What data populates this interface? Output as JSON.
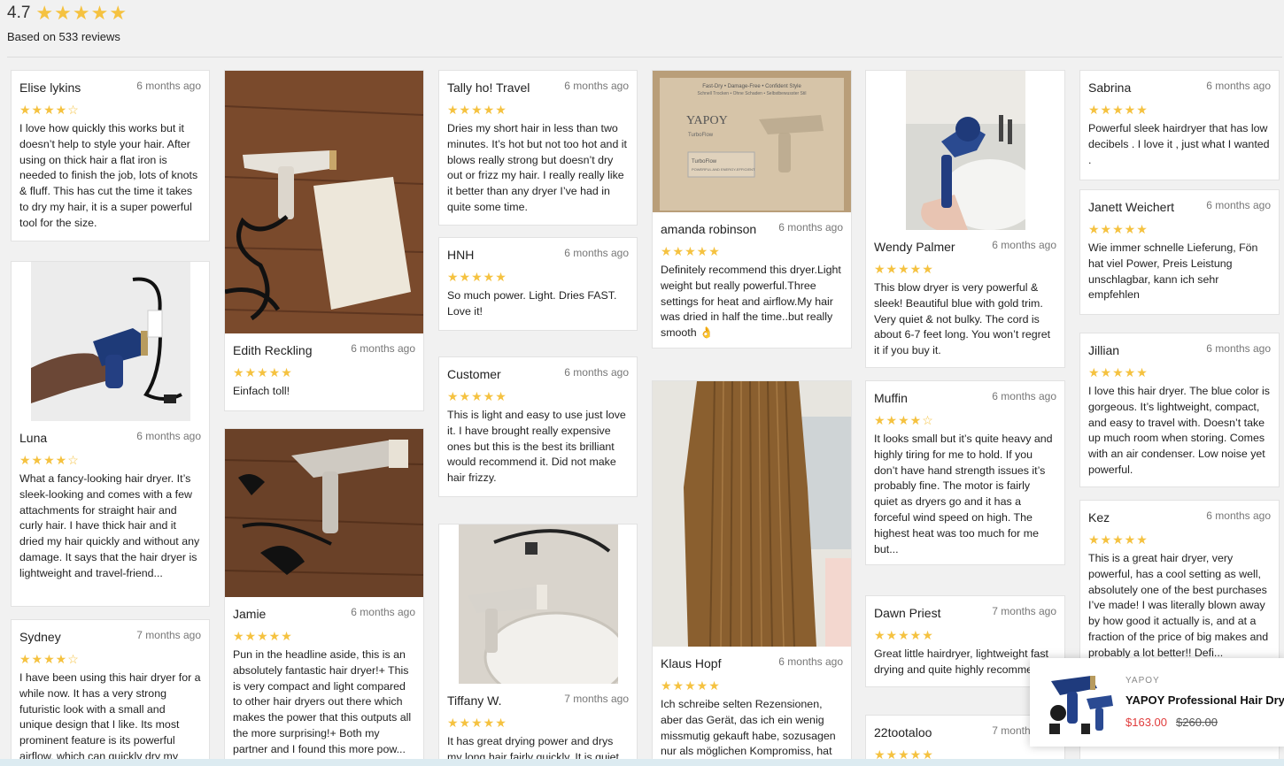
{
  "summary": {
    "score": "4.7",
    "stars": "★★★★★",
    "based_on": "Based on 533 reviews"
  },
  "star_color": "#f5c240",
  "reviews": [
    {
      "name": "Elise lykins",
      "date": "6 months ago",
      "stars": "★★★★☆",
      "rating": 4,
      "text": "I love how quickly this works but it doesn’t help to style your hair. After using on thick hair a flat iron is needed to finish the job, lots of knots & fluff. This has cut the time it takes to dry my hair, it is a super powerful tool for the size."
    },
    {
      "name": "Luna",
      "date": "6 months ago",
      "stars": "★★★★☆",
      "rating": 4,
      "text": "What a fancy-looking hair dryer. It’s sleek-looking and comes with a few attachments for straight hair and curly hair. I have thick hair and it dried my hair quickly and without any damage. It says that the hair dryer is lightweight and travel-friend..."
    },
    {
      "name": "Sydney",
      "date": "7 months ago",
      "stars": "★★★★☆",
      "rating": 4,
      "text": "I have been using this hair dryer for a while now. It has a very strong futuristic look with a small and unique design that I like. Its most prominent feature is its powerful airflow, which can quickly dry my"
    },
    {
      "name": "Edith Reckling",
      "date": "6 months ago",
      "stars": "★★★★★",
      "rating": 5,
      "text": "Einfach toll!"
    },
    {
      "name": "Jamie",
      "date": "6 months ago",
      "stars": "★★★★★",
      "rating": 5,
      "text": "Pun in the headline aside, this is an absolutely fantastic hair dryer!+ This is very compact and light compared to other hair dryers out there which makes the power that this outputs all the more surprising!+ Both my partner and I found this more pow..."
    },
    {
      "name": "Tally ho! Travel",
      "date": "6 months ago",
      "stars": "★★★★★",
      "rating": 5,
      "text": "Dries my short hair in less than two minutes. It’s hot but not too hot and it blows really strong but doesn’t dry out or frizz my hair. I really really like it better than any dryer I’ve had in quite some time."
    },
    {
      "name": "HNH",
      "date": "6 months ago",
      "stars": "★★★★★",
      "rating": 5,
      "text": "So much power. Light. Dries FAST. Love it!"
    },
    {
      "name": "Customer",
      "date": "6 months ago",
      "stars": "★★★★★",
      "rating": 5,
      "text": "This is light and easy to use just love it. I have brought really expensive ones but this is the best its brilliant would recommend it. Did not make hair frizzy."
    },
    {
      "name": "Tiffany W.",
      "date": "7 months ago",
      "stars": "★★★★★",
      "rating": 5,
      "text": "It has great drying power and drys my long hair fairly quickly. It is quiet"
    },
    {
      "name": "amanda robinson",
      "date": "6 months ago",
      "stars": "★★★★★",
      "rating": 5,
      "text": "Definitely recommend this dryer.Light weight but really powerful.Three settings for heat and airflow.My hair was dried in half the time..but really smooth 👌"
    },
    {
      "name": "Klaus Hopf",
      "date": "6 months ago",
      "stars": "★★★★★",
      "rating": 5,
      "text": "Ich schreibe selten Rezensionen, aber das Gerät, das ich ein wenig missmutig gekauft habe, sozusagen nur als möglichen Kompromiss, hat"
    },
    {
      "name": "Wendy Palmer",
      "date": "6 months ago",
      "stars": "★★★★★",
      "rating": 5,
      "text": "This blow dryer is very powerful & sleek! Beautiful blue with gold trim. Very quiet & not bulky. The cord is about 6-7 feet long. You won’t regret it if you buy it."
    },
    {
      "name": "Muffin",
      "date": "6 months ago",
      "stars": "★★★★☆",
      "rating": 4,
      "text": "It looks small but it’s quite heavy and highly tiring for me to hold. If you don’t have hand strength issues it’s probably fine. The motor is fairly quiet as dryers go and it has a forceful wind speed on high. The highest heat was too much for me but..."
    },
    {
      "name": "Dawn Priest",
      "date": "7 months ago",
      "stars": "★★★★★",
      "rating": 5,
      "text": "Great little hairdryer, lightweight fast drying and quite highly recommend"
    },
    {
      "name": "22tootaloo",
      "date": "7 months ago",
      "stars": "★★★★★",
      "rating": 5,
      "text": ""
    },
    {
      "name": "Sabrina",
      "date": "6 months ago",
      "stars": "★★★★★",
      "rating": 5,
      "text": "Powerful sleek hairdryer that has low decibels . I love it , just what I wanted ."
    },
    {
      "name": "Janett Weichert",
      "date": "6 months ago",
      "stars": "★★★★★",
      "rating": 5,
      "text": "Wie immer schnelle Lieferung, Fön hat viel Power, Preis Leistung unschlagbar, kann ich sehr empfehlen"
    },
    {
      "name": "Jillian",
      "date": "6 months ago",
      "stars": "★★★★★",
      "rating": 5,
      "text": "I love this hair dryer. The blue color is gorgeous. It’s lightweight, compact, and easy to travel with. Doesn’t take up much room when storing. Comes with an air condenser. Low noise yet powerful."
    },
    {
      "name": "Kez",
      "date": "6 months ago",
      "stars": "★★★★★",
      "rating": 5,
      "text": "This is a great hair dryer, very powerful, has a cool setting as well, absolutely one of the best purchases I’ve made! I was literally blown away by how good it actually is, and at a fraction of the price of big makes and probably a lot better!! Defi..."
    }
  ],
  "box_text": {
    "top_line": "Fast-Dry • Damage-Free • Confident Style",
    "second_line": "Schnell Trocken • Ohne Schaden • Selbstbewusster Stil",
    "brand": "YAPOY",
    "model": "TurboFlow",
    "label_model": "TurboFlow",
    "label_desc": "POWERFUL AND ENERGY-EFFICIENT"
  },
  "popup": {
    "brand": "YAPOY",
    "title": "YAPOY Professional Hair Dry",
    "price": "$163.00",
    "old_price": "$260.00"
  }
}
